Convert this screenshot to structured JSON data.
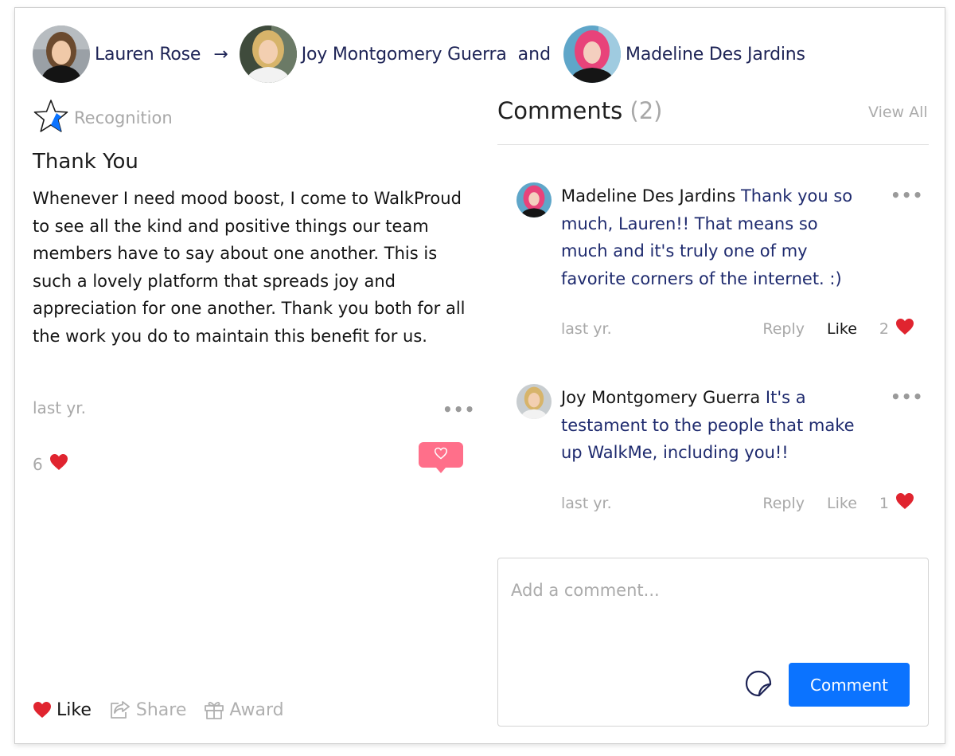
{
  "header": {
    "giver": "Lauren Rose",
    "arrow": "→",
    "recipient_1": "Joy Montgomery Guerra",
    "conjunction": "and",
    "recipient_2": "Madeline Des Jardins"
  },
  "post": {
    "category": "Recognition",
    "title": "Thank You",
    "body": "Whenever I need mood boost, I come to WalkProud to see all the kind and positive things our team members have to say about one another. This is such a lovely platform that spreads joy and appreciation for one another. Thank you both for all the work you do to maintain this benefit for us.",
    "time": "last yr.",
    "more": "•••",
    "likes": "6",
    "heart": "❤️"
  },
  "actions": {
    "like": "Like",
    "share": "Share",
    "award": "Award"
  },
  "comments_panel": {
    "title": "Comments",
    "count": "(2)",
    "view_all": "View All",
    "items": [
      {
        "author": "Madeline Des Jardins",
        "text": "Thank you so much, Lauren!! That means so much and it's truly one of my favorite corners of the internet. :)",
        "time": "last yr.",
        "reply": "Reply",
        "like": "Like",
        "likes": "2",
        "more": "•••"
      },
      {
        "author": "Joy Montgomery Guerra",
        "text": "It's a testament to the people that make up WalkMe, including you!!",
        "time": "last yr.",
        "reply": "Reply",
        "like": "Like",
        "likes": "1",
        "more": "•••"
      }
    ],
    "input_placeholder": "Add a comment...",
    "submit": "Comment"
  },
  "colors": {
    "accent_blue": "#0b73ff",
    "name_navy": "#1e2456",
    "heart_red": "#e0242f",
    "heart_tip_pink": "#ff6f8a",
    "muted_gray": "#a8a8a8"
  },
  "icons": {
    "category": "star-icon",
    "heart": "heart-icon",
    "share": "share-icon",
    "award": "gift-icon",
    "sticker": "sticker-icon"
  }
}
